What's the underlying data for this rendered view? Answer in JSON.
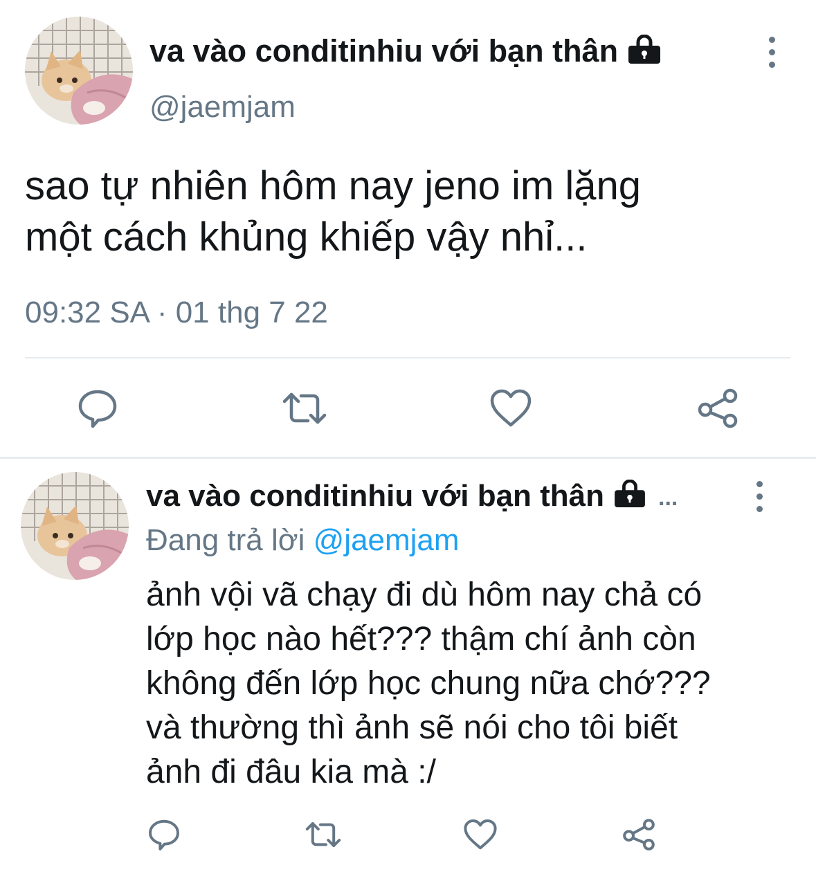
{
  "main_tweet": {
    "display_name": "va vào conditinhiu với bạn thân",
    "handle": "@jaemjam",
    "text_line_1": "sao tự nhiên hôm nay jeno im lặng",
    "text_line_2": "một cách khủng khiếp vậy nhỉ...",
    "timestamp": "09:32 SA · 01 thg 7 22",
    "icons": [
      "lock-icon",
      "more-vertical-icon",
      "reply-icon",
      "retweet-icon",
      "like-icon",
      "share-icon"
    ]
  },
  "reply_tweet": {
    "display_name": "va vào conditinhiu với bạn thân",
    "truncation": "...",
    "replying_prefix": "Đang trả lời",
    "replying_handle": "@jaemjam",
    "text_lines": [
      "ảnh vội vã chạy đi dù hôm nay chả có",
      "lớp học nào hết??? thậm chí ảnh còn",
      "không đến lớp học chung nữa chớ???",
      "và thường thì ảnh sẽ nói cho tôi biết",
      "ảnh đi đâu kia mà :/"
    ]
  },
  "colors": {
    "text_primary": "#14171a",
    "text_secondary": "#657786",
    "mention": "#1da1f2",
    "divider": "#e6ecf0"
  }
}
